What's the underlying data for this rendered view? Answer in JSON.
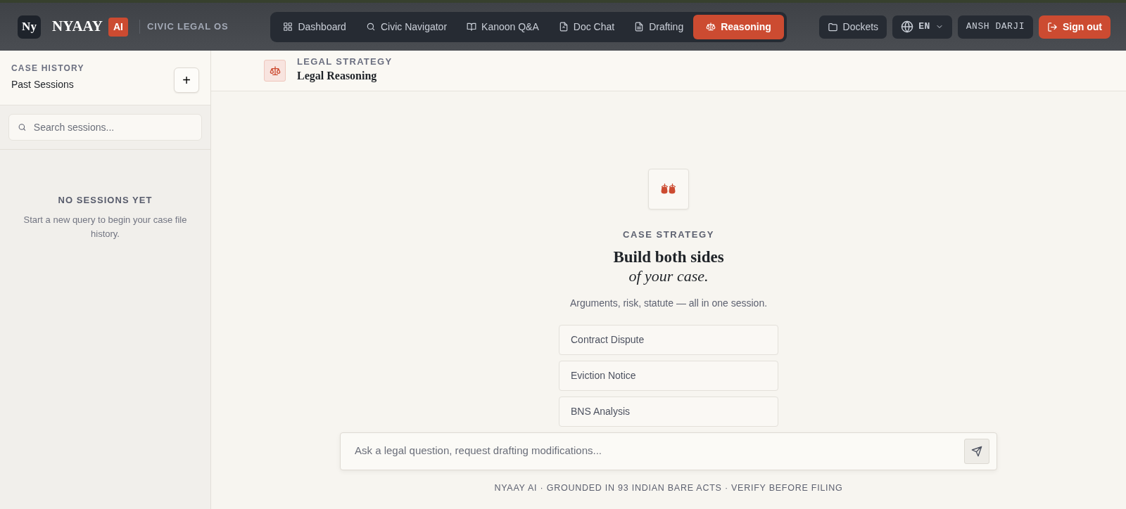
{
  "brand": {
    "logo": "Ny",
    "name": "NYAAY",
    "badge": "AI",
    "tagline": "CIVIC LEGAL OS"
  },
  "nav": [
    {
      "label": "Dashboard",
      "selected": false
    },
    {
      "label": "Civic Navigator",
      "selected": false
    },
    {
      "label": "Kanoon Q&A",
      "selected": false
    },
    {
      "label": "Doc Chat",
      "selected": false
    },
    {
      "label": "Drafting",
      "selected": false
    },
    {
      "label": "Reasoning",
      "selected": true
    }
  ],
  "actions": {
    "dockets": "Dockets",
    "language": "EN",
    "user": "ANSH DARJI",
    "sign_out": "Sign out"
  },
  "sidebar": {
    "eyebrow": "CASE HISTORY",
    "title": "Past Sessions",
    "add": "+",
    "search": {
      "placeholder": "Search sessions..."
    },
    "empty": {
      "title": "NO SESSIONS YET",
      "text": "Start a new query to begin your case file history."
    }
  },
  "header": {
    "eyebrow": "LEGAL STRATEGY",
    "title": "Legal Reasoning"
  },
  "hero": {
    "eyebrow": "CASE STRATEGY",
    "title": "Build both sides",
    "subtitle": "of your case.",
    "text": "Arguments, risk, statute — all in one session."
  },
  "suggestions": [
    "Contract Dispute",
    "Eviction Notice",
    "BNS Analysis"
  ],
  "composer": {
    "placeholder": "Ask a legal question, request drafting modifications..."
  },
  "footer": "NYAAY AI · GROUNDED IN 93 INDIAN BARE ACTS · VERIFY BEFORE FILING"
}
